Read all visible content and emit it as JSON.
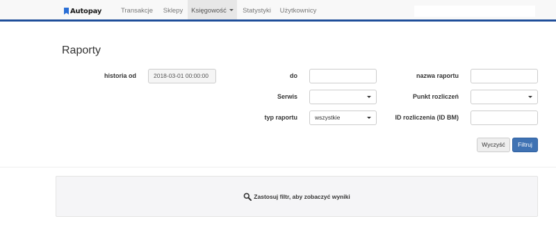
{
  "app": {
    "logo_text": "Autopay",
    "brand_color": "#1f4e9a"
  },
  "nav": {
    "items": [
      {
        "label": "Transakcje"
      },
      {
        "label": "Sklepy"
      },
      {
        "label": "Księgowość"
      },
      {
        "label": "Statystyki"
      },
      {
        "label": "Użytkownicy"
      }
    ],
    "active_index": 2
  },
  "page": {
    "title": "Raporty"
  },
  "form": {
    "historia_od": {
      "label": "historia od",
      "value": "2018-03-01 00:00:00"
    },
    "do": {
      "label": "do",
      "value": ""
    },
    "nazwa_raportu": {
      "label": "nazwa raportu",
      "value": ""
    },
    "serwis": {
      "label": "Serwis",
      "selected": ""
    },
    "punkt_rozliczen": {
      "label": "Punkt rozliczeń",
      "selected": ""
    },
    "typ_raportu": {
      "label": "typ raportu",
      "selected": "wszystkie"
    },
    "id_rozliczenia": {
      "label": "ID rozliczenia (ID BM)",
      "value": ""
    }
  },
  "buttons": {
    "clear": "Wyczyść",
    "filter": "Filtruj"
  },
  "results": {
    "message": "Zastosuj filtr, aby zobaczyć wyniki",
    "icon": "search-icon"
  }
}
